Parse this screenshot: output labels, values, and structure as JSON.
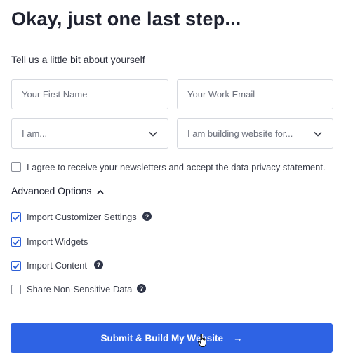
{
  "header": {
    "title": "Okay, just one last step..."
  },
  "form": {
    "subtitle": "Tell us a little bit about yourself",
    "first_name": {
      "placeholder": "Your First Name",
      "value": ""
    },
    "work_email": {
      "placeholder": "Your Work Email",
      "value": ""
    },
    "role_select": {
      "selected": "I am..."
    },
    "purpose_select": {
      "selected": "I am building website for..."
    },
    "newsletter_consent": {
      "label": "I agree to receive your newsletters and accept the data privacy statement.",
      "checked": false
    }
  },
  "advanced": {
    "label": "Advanced Options",
    "options": [
      {
        "label": "Import Customizer Settings",
        "checked": true,
        "help": true
      },
      {
        "label": "Import Widgets",
        "checked": true,
        "help": false
      },
      {
        "label": "Import Content",
        "checked": true,
        "help": true
      },
      {
        "label": "Share Non-Sensitive Data",
        "checked": false,
        "help": true
      }
    ],
    "help_glyph": "?"
  },
  "submit": {
    "label": "Submit & Build My Website",
    "arrow": "→"
  },
  "colors": {
    "primary": "#2e63e4",
    "text": "#1f2230",
    "border": "#d6d9df",
    "help_bg": "#2f3548"
  }
}
